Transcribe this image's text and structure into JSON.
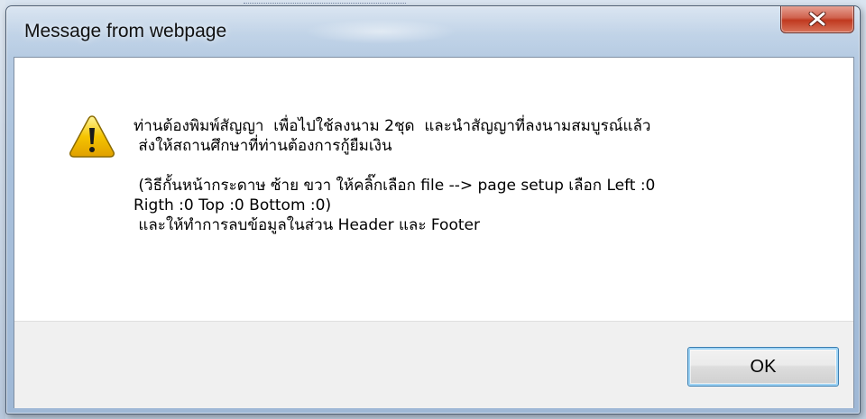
{
  "dialog": {
    "title": "Message from webpage",
    "close_label": "X",
    "icon": "warning-icon",
    "message_lines": [
      "ท่านต้องพิมพ์สัญญา  เพื่อไปใช้ลงนาม 2ชุด  และนำสัญญาที่ลงนามสมบูรณ์แล้ว",
      " ส่งให้สถานศึกษาที่ท่านต้องการกู้ยืมเงิน",
      "",
      " (วิธีกั้นหน้ากระดาษ ซ้าย ขวา ให้คลิ๊กเลือก file --> page setup เลือก Left :0",
      "Rigth :0 Top :0 Bottom :0)",
      " และให้ทำการลบข้อมูลในส่วน Header และ Footer"
    ],
    "ok_label": "OK"
  },
  "colors": {
    "close_button": "#c0391f",
    "warning_fill": "#f5c400",
    "ok_focus": "#3c7fb1"
  }
}
